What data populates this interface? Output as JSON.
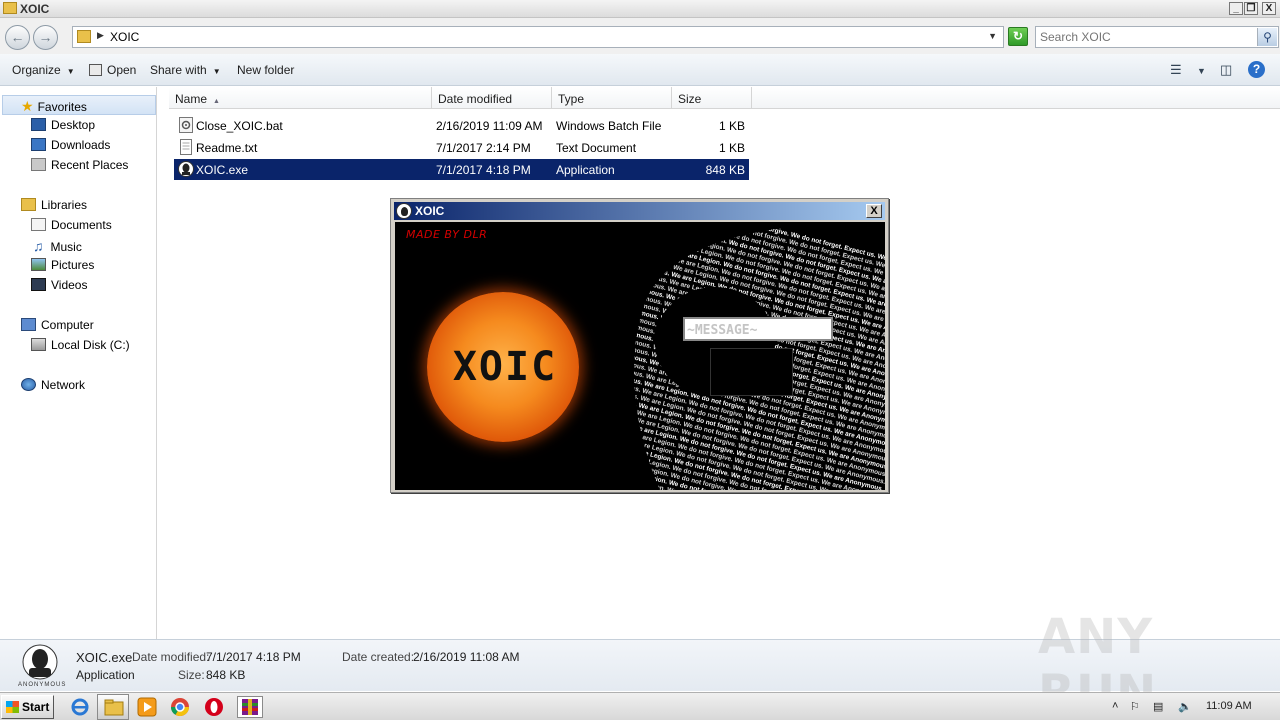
{
  "window": {
    "title": "XOIC",
    "controls": [
      "_",
      "❐",
      "X"
    ]
  },
  "address": {
    "path": "XOIC",
    "search_placeholder": "Search XOIC"
  },
  "toolbar": {
    "organize": "Organize",
    "open": "Open",
    "share_with": "Share with",
    "new_folder": "New folder"
  },
  "sidebar": {
    "favorites": "Favorites",
    "desktop": "Desktop",
    "downloads": "Downloads",
    "recent_places": "Recent Places",
    "libraries": "Libraries",
    "documents": "Documents",
    "music": "Music",
    "pictures": "Pictures",
    "videos": "Videos",
    "computer": "Computer",
    "local_disk": "Local Disk (C:)",
    "network": "Network"
  },
  "columns": {
    "name": "Name",
    "date_modified": "Date modified",
    "type": "Type",
    "size": "Size"
  },
  "files": [
    {
      "name": "Close_XOIC.bat",
      "date": "2/16/2019 11:09 AM",
      "type": "Windows Batch File",
      "size": "1 KB",
      "icon": "batch-file-icon"
    },
    {
      "name": "Readme.txt",
      "date": "7/1/2017 2:14 PM",
      "type": "Text Document",
      "size": "1 KB",
      "icon": "text-file-icon"
    },
    {
      "name": "XOIC.exe",
      "date": "7/1/2017 4:18 PM",
      "type": "Application",
      "size": "848 KB",
      "icon": "anonymous-app-icon",
      "selected": true
    }
  ],
  "dialog": {
    "title": "XOIC",
    "close": "X",
    "made_by": "MADE BY DLR",
    "logo_text": "XOIC",
    "message_value": "~MESSAGE~",
    "wall_text": "We are Anonymous. We are Legion. We do not forgive. We do not forget. Expect us."
  },
  "details": {
    "name": "XOIC.exe",
    "kind": "Application",
    "date_modified_label": "Date modified:",
    "date_modified": "7/1/2017 4:18 PM",
    "size_label": "Size:",
    "size": "848 KB",
    "date_created_label": "Date created:",
    "date_created": "2/16/2019 11:08 AM",
    "icon_caption": "ANONYMOUS"
  },
  "taskbar": {
    "start": "Start",
    "clock": "11:09 AM"
  },
  "watermark": "ANY RUN"
}
